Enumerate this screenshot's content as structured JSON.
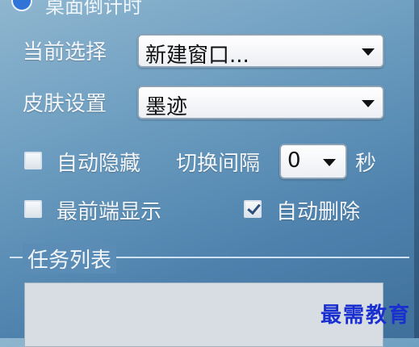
{
  "top": {
    "title": "桌面倒计时"
  },
  "settings": {
    "current_select_label": "当前选择",
    "current_select_value": "新建窗口...",
    "skin_label": "皮肤设置",
    "skin_value": "墨迹",
    "auto_hide_label": "自动隐藏",
    "auto_hide_checked": false,
    "switch_interval_label": "切换间隔",
    "switch_interval_value": "0",
    "seconds_label": "秒",
    "always_on_top_label": "最前端显示",
    "always_on_top_checked": false,
    "auto_delete_label": "自动删除",
    "auto_delete_checked": true
  },
  "tasks": {
    "group_title": "任务列表"
  },
  "watermark": "最需教育"
}
